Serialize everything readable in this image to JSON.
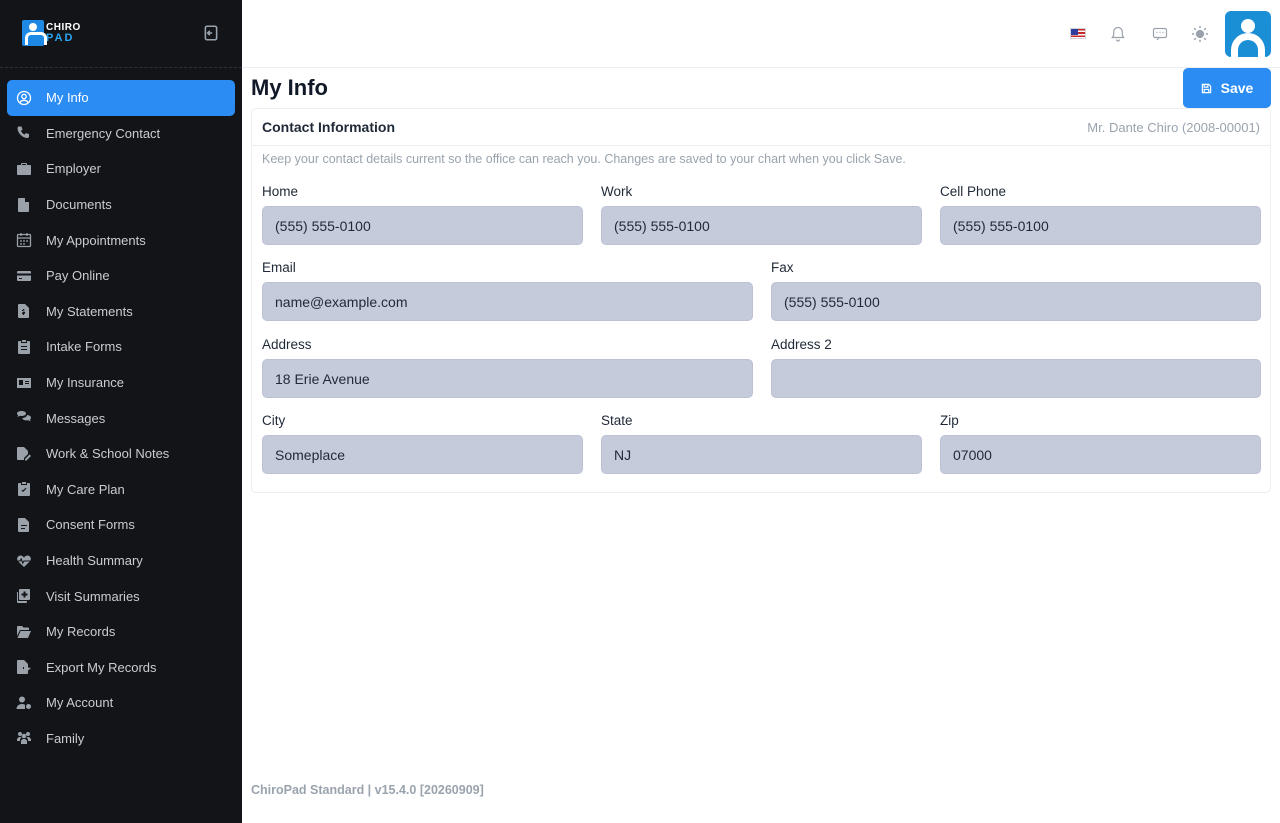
{
  "sidebar": {
    "logo": {
      "line1": "CHIRO",
      "line2": "PAD"
    },
    "items": [
      {
        "label": "My Info",
        "icon": "user-circle-icon"
      },
      {
        "label": "Emergency Contact",
        "icon": "phone-icon"
      },
      {
        "label": "Employer",
        "icon": "briefcase-icon"
      },
      {
        "label": "Documents",
        "icon": "document-icon"
      },
      {
        "label": "My Appointments",
        "icon": "calendar-icon"
      },
      {
        "label": "Pay Online",
        "icon": "credit-card-icon"
      },
      {
        "label": "My Statements",
        "icon": "statement-icon"
      },
      {
        "label": "Intake Forms",
        "icon": "clipboard-icon"
      },
      {
        "label": "My Insurance",
        "icon": "id-card-icon"
      },
      {
        "label": "Messages",
        "icon": "chat-icon"
      },
      {
        "label": "Work & School Notes",
        "icon": "note-signature-icon"
      },
      {
        "label": "My Care Plan",
        "icon": "clipboard-check-icon"
      },
      {
        "label": "Consent Forms",
        "icon": "form-icon"
      },
      {
        "label": "Health Summary",
        "icon": "heart-pulse-icon"
      },
      {
        "label": "Visit Summaries",
        "icon": "notes-medical-icon"
      },
      {
        "label": "My Records",
        "icon": "folder-open-icon"
      },
      {
        "label": "Export My Records",
        "icon": "file-export-icon"
      },
      {
        "label": "My Account",
        "icon": "user-gear-icon"
      },
      {
        "label": "Family",
        "icon": "users-icon"
      }
    ]
  },
  "topbar": {
    "icons": [
      "us-flag-icon",
      "bell-icon",
      "message-icon",
      "sun-icon",
      "avatar"
    ]
  },
  "main": {
    "title": "My Info",
    "save_label": "Save",
    "card": {
      "title": "Contact Information",
      "patient": "Mr. Dante Chiro (2008-00001)",
      "hint": "Keep your contact details current so the office can reach you. Changes are saved to your chart when you click Save.",
      "fields": {
        "home": {
          "label": "Home",
          "value": "(555) 555-0100"
        },
        "work": {
          "label": "Work",
          "value": "(555) 555-0100"
        },
        "cell": {
          "label": "Cell Phone",
          "value": "(555) 555-0100"
        },
        "email": {
          "label": "Email",
          "value": "name@example.com"
        },
        "fax": {
          "label": "Fax",
          "value": "(555) 555-0100"
        },
        "address": {
          "label": "Address",
          "value": "18 Erie Avenue"
        },
        "address2": {
          "label": "Address 2",
          "value": ""
        },
        "city": {
          "label": "City",
          "value": "Someplace"
        },
        "state": {
          "label": "State",
          "value": "NJ"
        },
        "zip": {
          "label": "Zip",
          "value": "07000"
        }
      }
    }
  },
  "footer": {
    "text": "ChiroPad Standard | v15.4.0 [20260909]"
  },
  "colors": {
    "sidebar_bg": "#121417",
    "accent": "#2b8cf3",
    "input_bg": "#c6cbdb"
  }
}
